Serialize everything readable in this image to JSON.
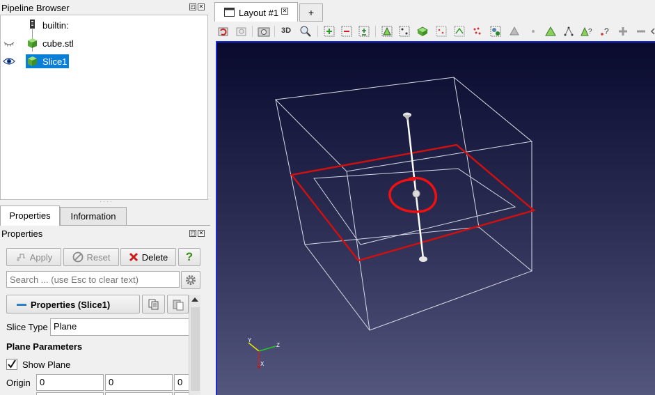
{
  "pipeline_browser": {
    "title": "Pipeline Browser",
    "items": [
      {
        "label": "builtin:",
        "icon": "server-icon",
        "visible": null
      },
      {
        "label": "cube.stl",
        "icon": "green-cube-icon",
        "visible": false
      },
      {
        "label": "Slice1",
        "icon": "green-cube-icon",
        "visible": true,
        "selected": true
      }
    ]
  },
  "tabs": {
    "properties": "Properties",
    "information": "Information"
  },
  "properties_panel": {
    "title": "Properties",
    "apply": "Apply",
    "reset": "Reset",
    "delete": "Delete",
    "help": "?",
    "search_placeholder": "Search ... (use Esc to clear text)",
    "section_title": "Properties (Slice1)",
    "slice_type_label": "Slice Type",
    "slice_type_value": "Plane",
    "plane_params_title": "Plane Parameters",
    "show_plane_label": "Show Plane",
    "show_plane_checked": true,
    "origin_label": "Origin",
    "origin_values": [
      "0",
      "0",
      "0"
    ]
  },
  "layout": {
    "tab_label": "Layout #1",
    "new_tab": "+",
    "toolbar_3d": "3D"
  },
  "colors": {
    "accent": "#0a7fd8",
    "slice_outline": "#cc1111",
    "annotation_circle": "#ee1111",
    "viewport_border": "#1a2bd6",
    "bg_top": "#090a2e",
    "bg_bottom": "#53567d"
  },
  "axes": {
    "x": "X",
    "y": "Y",
    "z": "Z"
  }
}
